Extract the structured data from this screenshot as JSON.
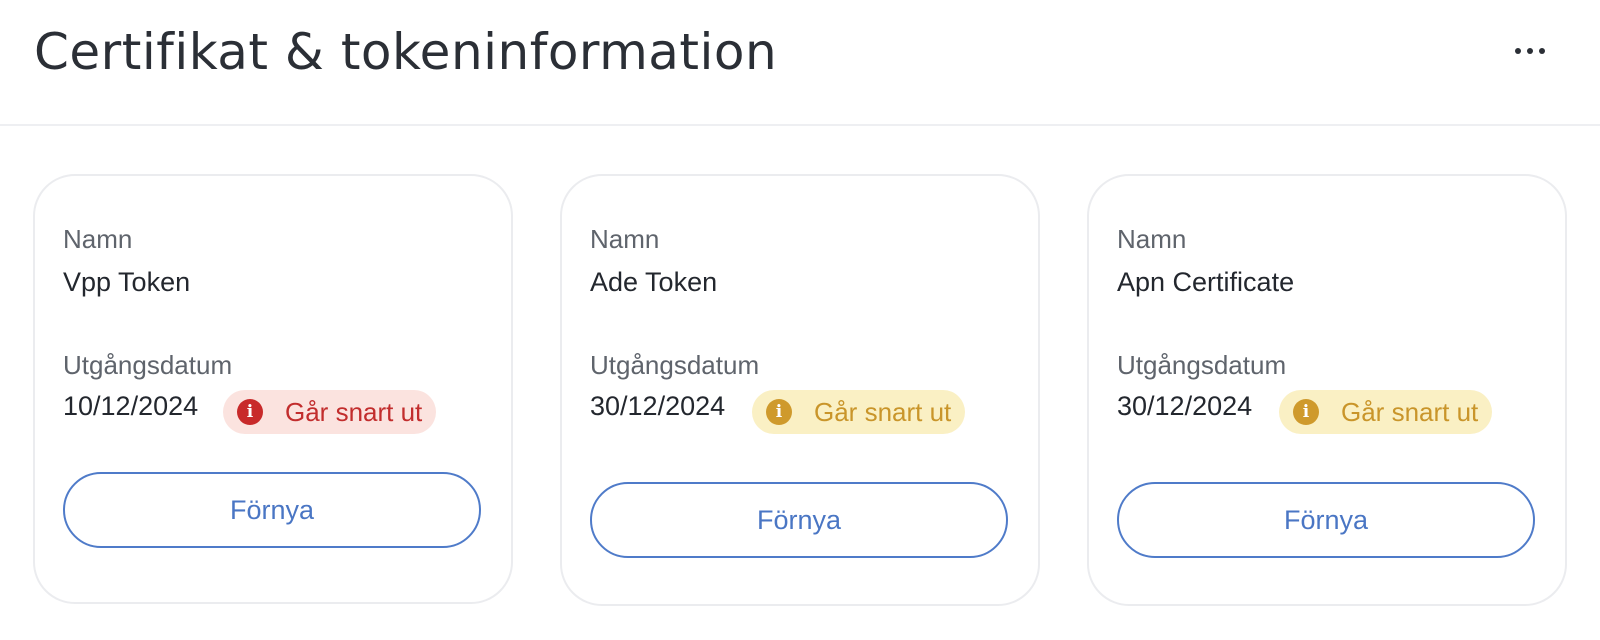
{
  "header": {
    "title": "Certifikat & tokeninformation",
    "more_icon": "more-horizontal-icon"
  },
  "cards": [
    {
      "name_label": "Namn",
      "name": "Vpp Token",
      "expiry_label": "Utgångsdatum",
      "expiry_date": "10/12/2024",
      "status_text": "Går snart ut",
      "status_icon": "i",
      "status_color": "#c82a2a",
      "status_bg": "#fbe3df",
      "button_label": "Förnya"
    },
    {
      "name_label": "Namn",
      "name": "Ade Token",
      "expiry_label": "Utgångsdatum",
      "expiry_date": "30/12/2024",
      "status_text": "Går snart ut",
      "status_icon": "i",
      "status_color": "#cf9a2c",
      "status_bg": "#faf0c4",
      "button_label": "Förnya"
    },
    {
      "name_label": "Namn",
      "name": "Apn Certificate",
      "expiry_label": "Utgångsdatum",
      "expiry_date": "30/12/2024",
      "status_text": "Går snart ut",
      "status_icon": "i",
      "status_color": "#cf9a2c",
      "status_bg": "#faf0c4",
      "button_label": "Förnya"
    }
  ],
  "colors": {
    "accent": "#4a76c4",
    "border": "#ebecef"
  }
}
